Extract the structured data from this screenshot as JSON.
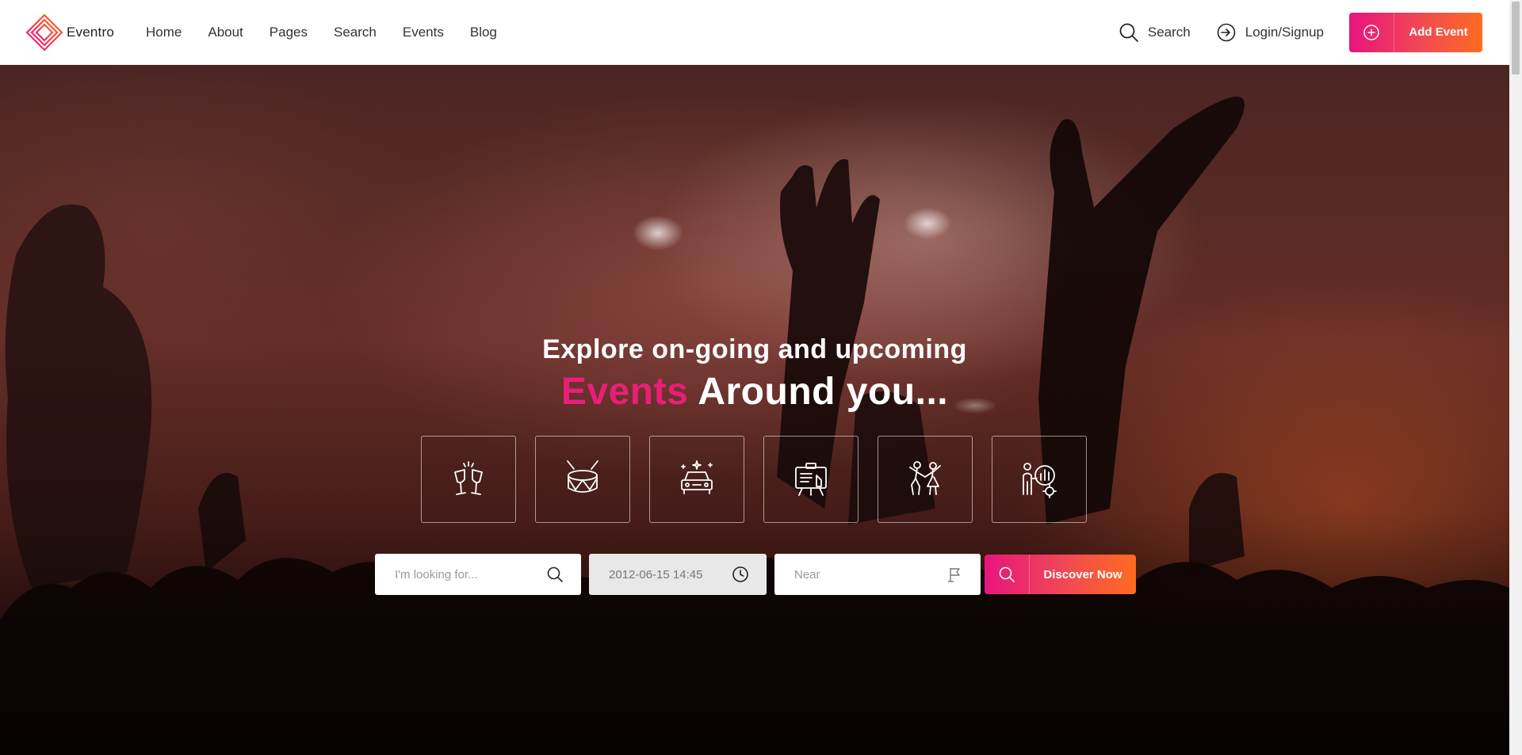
{
  "header": {
    "logo_text": "Eventro",
    "nav": [
      "Home",
      "About",
      "Pages",
      "Search",
      "Events",
      "Blog"
    ],
    "search_label": "Search",
    "login_label": "Login/Signup",
    "add_event_label": "Add Event"
  },
  "hero": {
    "title_line1": "Explore on-going and upcoming",
    "title_accent": "Events",
    "title_rest": "Around you...",
    "categories": [
      {
        "icon": "champagne-glasses-icon"
      },
      {
        "icon": "drum-icon"
      },
      {
        "icon": "car-icon"
      },
      {
        "icon": "presentation-board-icon"
      },
      {
        "icon": "dancing-couple-icon"
      },
      {
        "icon": "gears-analytics-icon"
      }
    ]
  },
  "search": {
    "looking_placeholder": "I'm looking for...",
    "date_value": "2012-06-15 14:45",
    "near_placeholder": "Near",
    "discover_label": "Discover Now"
  },
  "colors": {
    "accent_pink": "#e8157d",
    "accent_orange": "#ff6b1f",
    "title_accent": "#ea1e79"
  }
}
